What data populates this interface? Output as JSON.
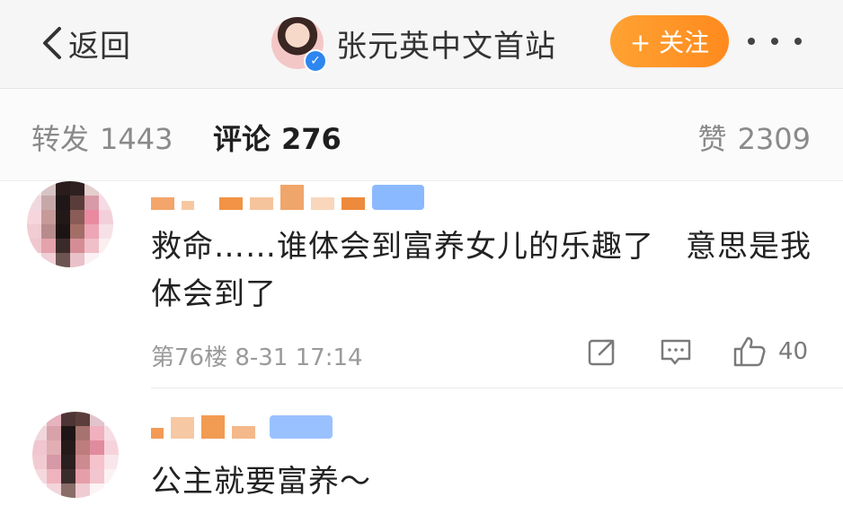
{
  "header": {
    "back_label": "返回",
    "account_name": "张元英中文首站",
    "follow_label": "+ 关注",
    "more_icon": "more-dots-icon",
    "verified_icon": "verified-badge-icon"
  },
  "tabs": {
    "repost": {
      "label": "转发",
      "count": "1443"
    },
    "comment": {
      "label": "评论",
      "count": "276"
    },
    "like": {
      "label": "赞",
      "count": "2309"
    }
  },
  "comments": [
    {
      "text": "救命……谁体会到富养女儿的乐趣了　意思是我体会到了",
      "meta": "第76楼 8-31 17:14",
      "like_count": "40",
      "icons": [
        "repost-icon",
        "comment-icon",
        "like-icon"
      ]
    },
    {
      "text": "公主就要富养～"
    }
  ],
  "colors": {
    "follow_orange": "#ff9a2b",
    "verified_blue": "#2e86f0",
    "muted_text": "#9a9a9a"
  }
}
